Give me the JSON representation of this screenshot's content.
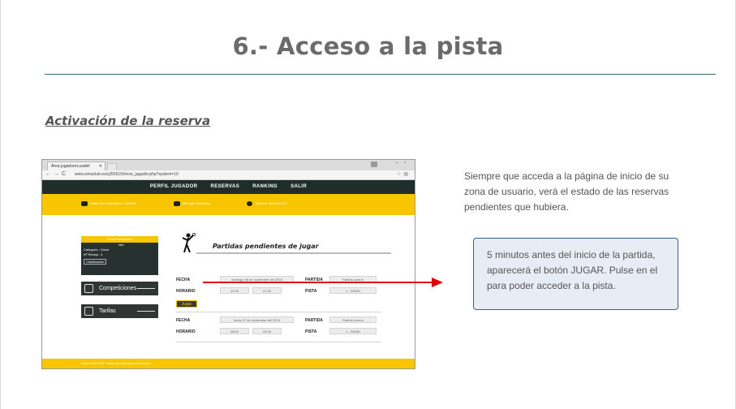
{
  "page": {
    "title": "6.- Acceso a la pista",
    "subtitle": "Activación de la reserva",
    "description": "Siempre que acceda a la página de inicio de su zona de usuario, verá el estado de las reservas pendientes que hubiera.",
    "note": "5 minutos antes del inicio de la partida, aparecerá el botón JUGAR. Pulse en el para poder acceder a la pista."
  },
  "screenshot": {
    "tab_title": "Área jugadores padel",
    "url": "www.zonaclub.es/cj/50615/inicio_jugador.php?system=10",
    "nav": [
      "PERFIL JUGADOR",
      "RESERVAS",
      "RANKING",
      "SALIR"
    ],
    "yellow_bar": {
      "saldo": "Saldo Bono Monedero: 100.00€",
      "mensaje": "Mensaje Monedero",
      "telefono": "Teléfono: 616 226 071"
    },
    "panel": {
      "header": "Ficha Participante",
      "line1": "Info",
      "line2": "Categoría : Única",
      "line3": "Nº Reciqu : 4",
      "button": "Clasificación"
    },
    "menu": [
      "Competiciones",
      "Tarifas"
    ],
    "pending_title": "Partidas pendientes de jugar",
    "labels": {
      "fecha": "FECHA",
      "horario": "HORARIO",
      "partida": "PARTIDA",
      "pista": "PISTA"
    },
    "reservations": [
      {
        "fecha": "domingo 06 de noviembre del 2016",
        "inicio": "20:00",
        "fin": "21:30",
        "partida": "Partida común",
        "pista": "1 - DEMO"
      },
      {
        "fecha": "lunes 07 de noviembre del 2016",
        "inicio": "08:00",
        "fin": "09:30",
        "partida": "Partida común",
        "pista": "1 - DEMO"
      }
    ],
    "jugar_label": "Jugar",
    "footer": "Zona Club 2016. Todos los derechos reservados."
  },
  "colors": {
    "accent_yellow": "#f7c600",
    "nav_dark": "#1f2e2b",
    "arrow_red": "#e00000",
    "note_border": "#3a5f8f",
    "note_bg": "#e8edf5"
  },
  "icons": [
    "tennis-player-icon",
    "wallet-icon",
    "car-icon",
    "phone-icon",
    "trophy-icon",
    "tag-icon",
    "arrow-right-icon"
  ]
}
